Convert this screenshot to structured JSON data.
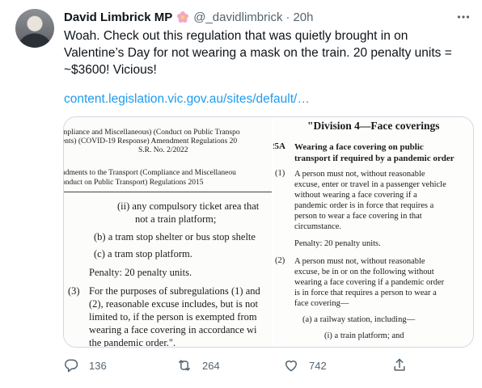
{
  "tweet": {
    "author_name": "David Limbrick MP",
    "author_emoji_icon": "flower-icon",
    "handle": "@_davidlimbrick",
    "separator": "·",
    "timestamp": "20h",
    "text": "Woah. Check out this regulation that was quietly brought in on Valentine’s Day for not wearing a mask on the train. 20 penalty units = ~$3600! Vicious!",
    "link": "content.legislation.vic.gov.au/sites/default/…"
  },
  "media": {
    "left": {
      "header_lines": [
        "mpliance and Miscellaneous) (Conduct on Public Transpo",
        "ents) (COVID-19 Response) Amendment Regulations 20",
        "S.R. No. 2/2022"
      ],
      "subheader_lines": [
        "ndments to the Transport (Compliance and Miscellaneou",
        "onduct on Public Transport) Regulations 2015"
      ],
      "item_ii_line1": "(ii)  any compulsory ticket area that",
      "item_ii_line2": "not a train platform;",
      "item_b": "(b)  a tram stop shelter or bus stop shelte",
      "item_c": "(c)  a tram stop platform.",
      "penalty": "Penalty: 20 penalty units.",
      "item_3_num": "(3)",
      "item_3_lines": [
        "For the purposes of subregulations (1) and",
        "(2), reasonable excuse includes, but is not",
        "limited to, if the person is exempted from",
        "wearing a face covering in accordance wi",
        "the pandemic order.\"."
      ]
    },
    "right": {
      "division_title": "\"Division 4—Face coverings",
      "section_num": "25A",
      "section_title_lines": [
        "Wearing a face covering on public",
        "transport if required by a pandemic order"
      ],
      "sub1_num": "(1)",
      "sub1_lines": [
        "A person must not, without reasonable",
        "excuse, enter or travel in a passenger vehicle",
        "without wearing a face covering if a",
        "pandemic order is in force that requires a",
        "person to wear a face covering in that",
        "circumstance."
      ],
      "penalty": "Penalty: 20 penalty units.",
      "sub2_num": "(2)",
      "sub2_lines": [
        "A person must not, without reasonable",
        "excuse, be in or on the following without",
        "wearing a face covering if a pandemic order",
        "is in force that requires a person to wear a",
        "face covering—"
      ],
      "item_a": "(a)  a railway station, including—",
      "item_i": "(i)  a train platform; and"
    }
  },
  "actions": {
    "reply": {
      "icon": "reply-icon",
      "count": "136"
    },
    "retweet": {
      "icon": "retweet-icon",
      "count": "264"
    },
    "like": {
      "icon": "heart-icon",
      "count": "742"
    },
    "share": {
      "icon": "share-icon"
    }
  },
  "colors": {
    "link": "#1d9bf0",
    "secondary_text": "#536471",
    "primary_text": "#0f1419",
    "border": "#cfd9de"
  }
}
